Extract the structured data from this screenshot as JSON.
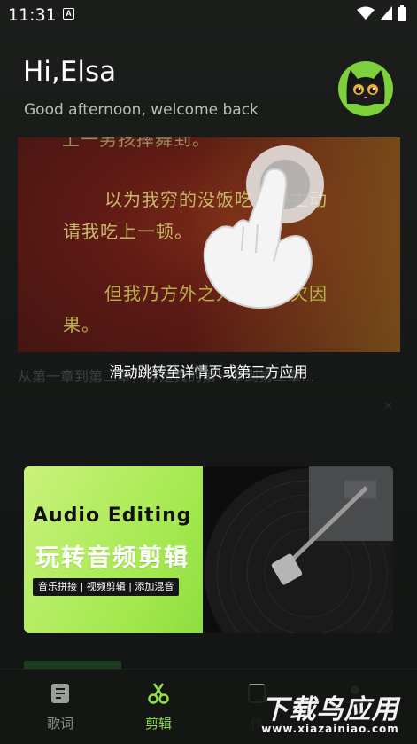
{
  "status_bar": {
    "time": "11:31",
    "badge": "A",
    "icons": [
      "wifi-icon",
      "signal-icon",
      "battery-icon"
    ]
  },
  "header": {
    "greeting": "Hi,Elsa",
    "subtitle": "Good afternoon, welcome back",
    "avatar_icon": "black-cat-avatar"
  },
  "lyric_card": {
    "lines": [
      "上一男孩摔舞到。",
      "以为我穷的没饭吃，便主动",
      "请我吃上一顿。",
      "但我乃方外之人，最惧欠因",
      "果。"
    ],
    "caption": "从第一章到第二章，你是真的第一章到第二章...",
    "overlay_text": "滑动跳转至详情页或第三方应用",
    "gesture_icon": "tap-hand-icon"
  },
  "banner": {
    "title": "Audio Editing",
    "subtitle": "玩转音频剪辑",
    "tag": "音乐拼接 | 视频剪辑 | 添加混音",
    "accent_color": "#8ee04a"
  },
  "bottom_nav": {
    "items": [
      {
        "label": "歌词",
        "icon": "lyrics-icon",
        "active": false
      },
      {
        "label": "剪辑",
        "icon": "scissors-icon",
        "active": true
      },
      {
        "label": "作",
        "icon": "works-icon",
        "active": false
      },
      {
        "label": "",
        "icon": "profile-icon",
        "active": false
      }
    ]
  },
  "watermark": {
    "text": "下载鸟应用",
    "url": "www.xiazainiao.com"
  }
}
